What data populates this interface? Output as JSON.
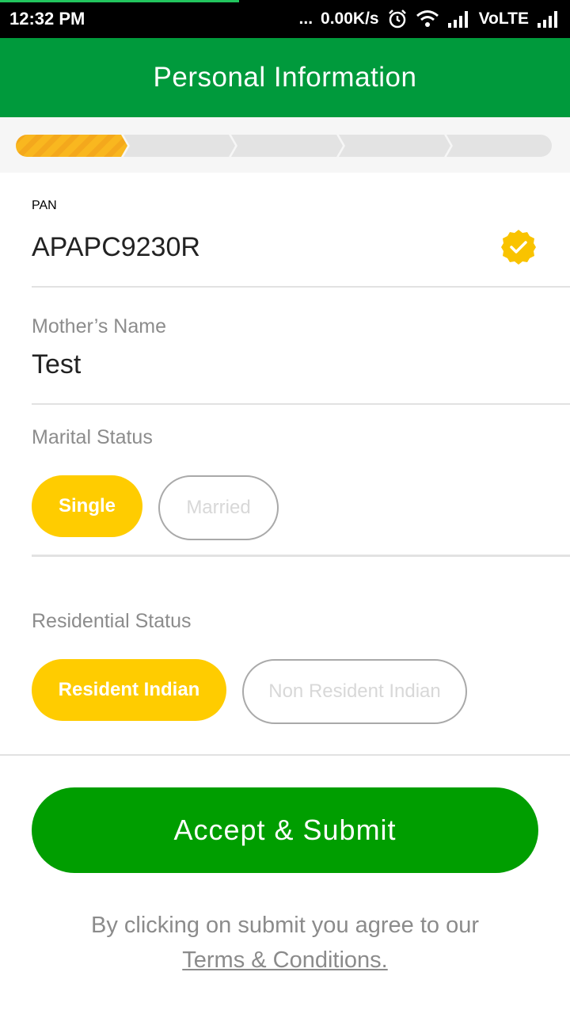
{
  "status_bar": {
    "time": "12:32 PM",
    "dots": "...",
    "speed": "0.00K/s",
    "network": "VoLTE"
  },
  "header": {
    "title": "Personal Information"
  },
  "progress": {
    "total_steps": 5,
    "completed_steps": 1,
    "active_color": "#f9b71f",
    "inactive_color": "#e3e3e3"
  },
  "form": {
    "pan": {
      "label": "PAN",
      "value": "APAPC9230R",
      "verified": true
    },
    "mothers_name": {
      "label": "Mother’s Name",
      "value": "Test"
    },
    "marital_status": {
      "label": "Marital Status",
      "options": [
        "Single",
        "Married"
      ],
      "selected": "Single"
    },
    "residential_status": {
      "label": "Residential Status",
      "options": [
        "Resident Indian",
        "Non Resident Indian"
      ],
      "selected": "Resident Indian"
    }
  },
  "submit": {
    "label": "Accept & Submit"
  },
  "footer": {
    "text": "By clicking on submit you agree to our",
    "link": "Terms & Conditions."
  },
  "colors": {
    "brand_green": "#009a3c",
    "button_green": "#009e00",
    "accent_yellow": "#ffcc00"
  }
}
